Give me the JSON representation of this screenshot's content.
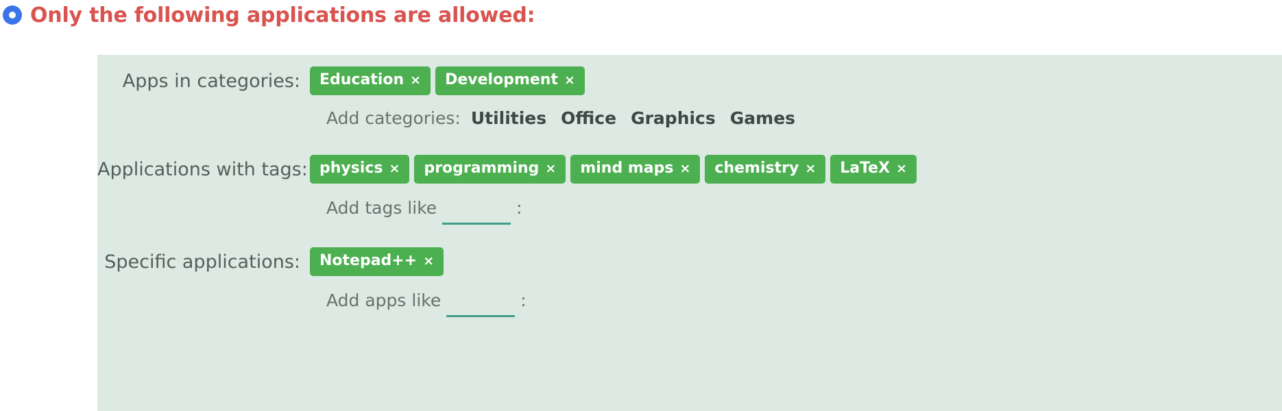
{
  "heading": {
    "radio_selected": true,
    "radio_color": "#3b74e8",
    "text": "Only the following applications are allowed:",
    "text_color": "#d9534f"
  },
  "panel": {
    "background_color": "#dde9e3",
    "chip_color": "#4caf50",
    "underline_color": "#3f9e89",
    "rows": [
      {
        "label": "Apps in categories:",
        "chips": [
          {
            "label": "Education",
            "remove": "×"
          },
          {
            "label": "Development",
            "remove": "×"
          }
        ],
        "add": {
          "label": "Add categories:",
          "suggestions": [
            "Utilities",
            "Office",
            "Graphics",
            "Games"
          ]
        }
      },
      {
        "label": "Applications with tags:",
        "chips": [
          {
            "label": "physics",
            "remove": "×"
          },
          {
            "label": "programming",
            "remove": "×"
          },
          {
            "label": "mind maps",
            "remove": "×"
          },
          {
            "label": "chemistry",
            "remove": "×"
          },
          {
            "label": "LaTeX",
            "remove": "×"
          }
        ],
        "add": {
          "label": "Add tags like",
          "input_value": "",
          "input_placeholder": "",
          "trailing": ":"
        }
      },
      {
        "label": "Specific applications:",
        "chips": [
          {
            "label": "Notepad++",
            "remove": "×"
          }
        ],
        "add": {
          "label": "Add apps like",
          "input_value": "",
          "input_placeholder": "",
          "trailing": ":"
        }
      }
    ]
  }
}
